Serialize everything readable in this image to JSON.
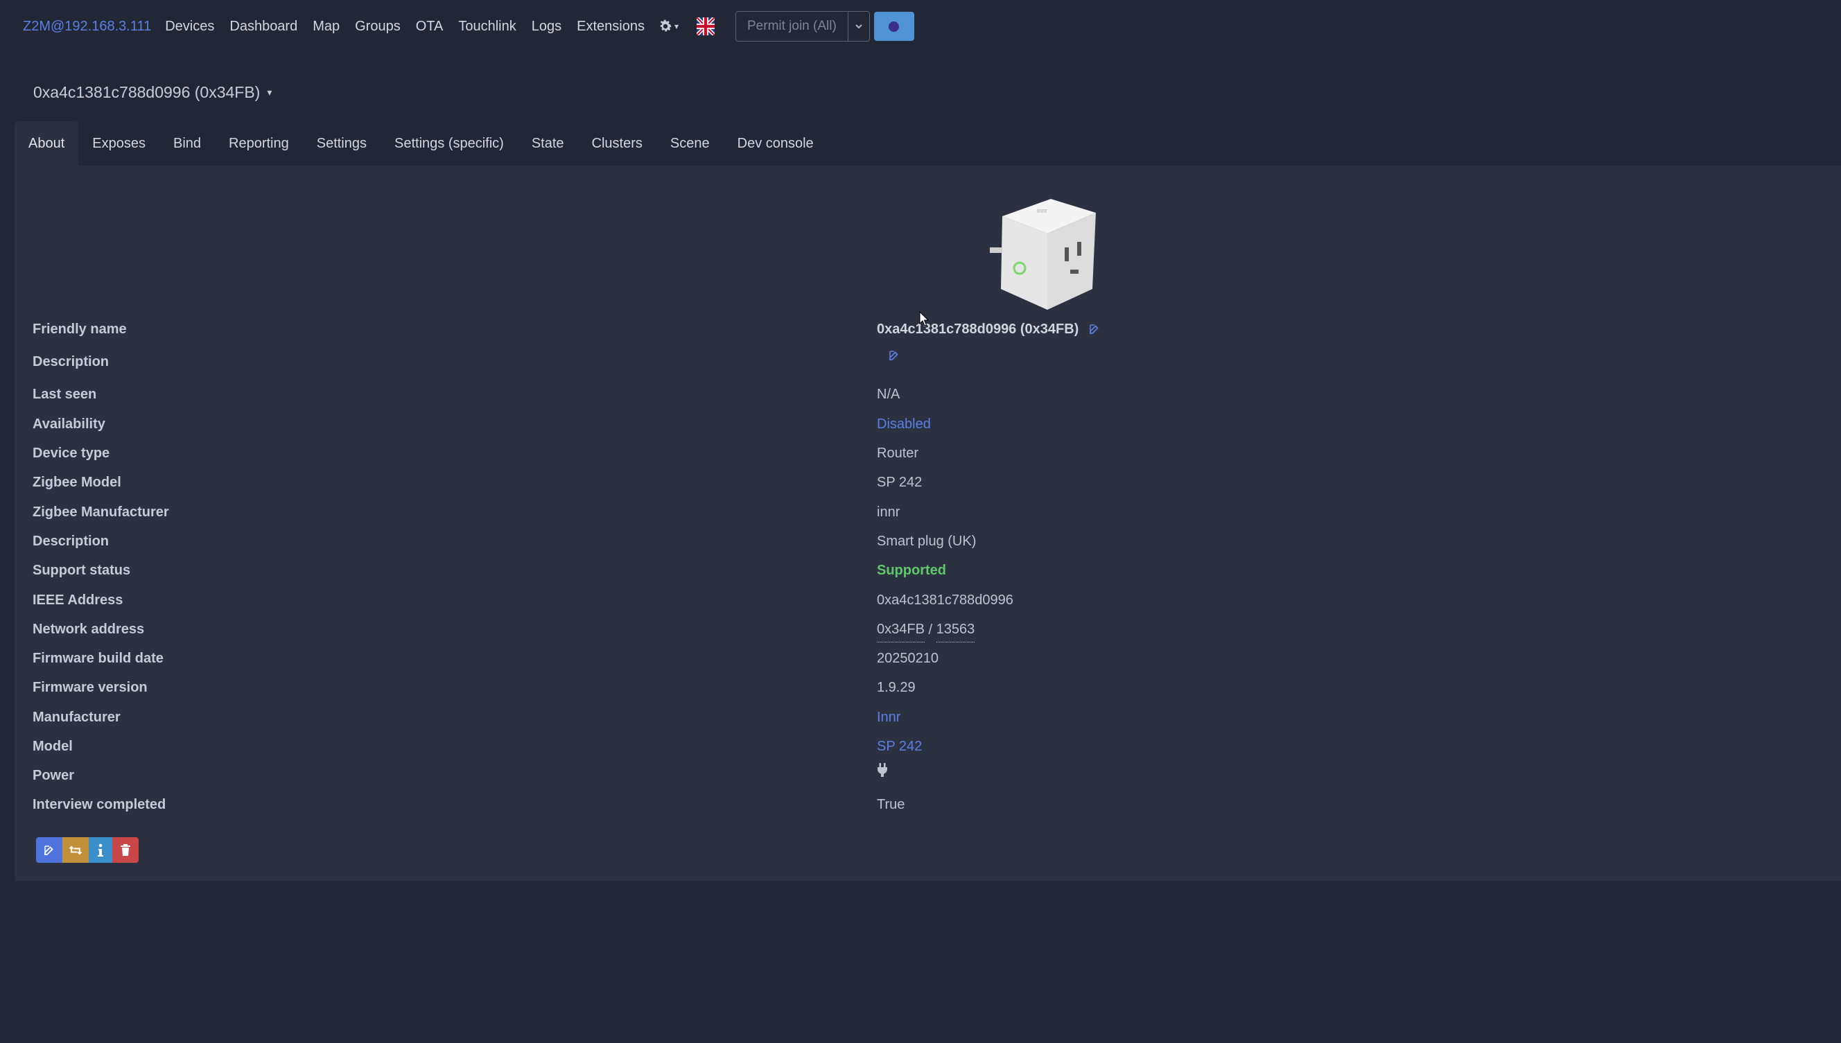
{
  "navbar": {
    "brand": "Z2M@192.168.3.111",
    "links": [
      "Devices",
      "Dashboard",
      "Map",
      "Groups",
      "OTA",
      "Touchlink",
      "Logs",
      "Extensions"
    ],
    "settings_icon": "gear-icon",
    "language_icon": "uk-flag-icon",
    "permit_join_label": "Permit join (All)"
  },
  "device": {
    "selector_label": "0xa4c1381c788d0996 (0x34FB)"
  },
  "tabs": [
    "About",
    "Exposes",
    "Bind",
    "Reporting",
    "Settings",
    "Settings (specific)",
    "State",
    "Clusters",
    "Scene",
    "Dev console"
  ],
  "active_tab": "About",
  "about": {
    "friendly_name": {
      "label": "Friendly name",
      "value": "0xa4c1381c788d0996 (0x34FB)"
    },
    "description_edit": {
      "label": "Description"
    },
    "last_seen": {
      "label": "Last seen",
      "value": "N/A"
    },
    "availability": {
      "label": "Availability",
      "value": "Disabled"
    },
    "device_type": {
      "label": "Device type",
      "value": "Router"
    },
    "zigbee_model": {
      "label": "Zigbee Model",
      "value": "SP 242"
    },
    "zigbee_manufacturer": {
      "label": "Zigbee Manufacturer",
      "value": "innr"
    },
    "description": {
      "label": "Description",
      "value": "Smart plug (UK)"
    },
    "support_status": {
      "label": "Support status",
      "value": "Supported"
    },
    "ieee_address": {
      "label": "IEEE Address",
      "value": "0xa4c1381c788d0996"
    },
    "network_address": {
      "label": "Network address",
      "hex": "0x34FB",
      "sep": " / ",
      "dec": "13563"
    },
    "firmware_build_date": {
      "label": "Firmware build date",
      "value": "20250210"
    },
    "firmware_version": {
      "label": "Firmware version",
      "value": "1.9.29"
    },
    "manufacturer": {
      "label": "Manufacturer",
      "value": "Innr"
    },
    "model": {
      "label": "Model",
      "value": "SP 242"
    },
    "power": {
      "label": "Power",
      "icon": "plug-icon"
    },
    "interview_completed": {
      "label": "Interview completed",
      "value": "True"
    }
  },
  "colors": {
    "background": "#222736",
    "panel": "#2b3141",
    "link": "#5b7fe3",
    "supported": "#5fc96a"
  }
}
